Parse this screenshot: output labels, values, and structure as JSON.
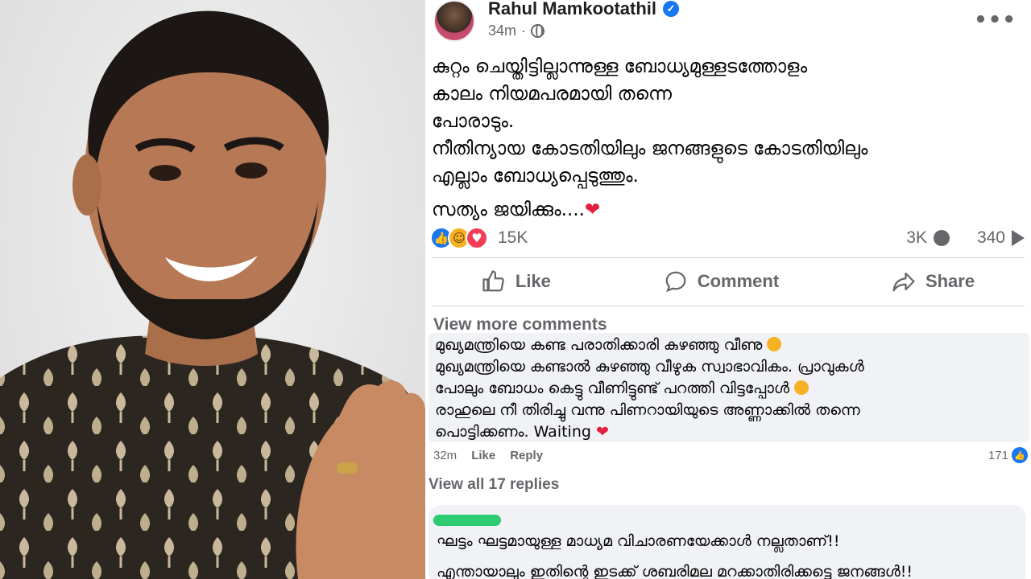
{
  "post": {
    "author": "Rahul Mamkootathil",
    "time": "34m",
    "more_icon": "more-horizontal-icon",
    "lines": [
      "കുറ്റം ചെയ്തിട്ടില്ലാന്നുള്ള ബോധ്യമുള്ളടത്തോളം",
      "കാലം നിയമപരമായി തന്നെ",
      "പോരാടും.",
      "നീതിന്യായ കോടതിയിലും ജനങ്ങളുടെ കോടതിയിലും",
      "എല്ലാം ബോധ്യപ്പെടുത്തും."
    ],
    "closing": "സത്യം ജയിക്കും....",
    "closing_emoji": "❤"
  },
  "stats": {
    "reactions": "15K",
    "comments": "3K",
    "shares": "340"
  },
  "actions": {
    "like": "Like",
    "comment": "Comment",
    "share": "Share"
  },
  "comments_section": {
    "view_more": "View more comments",
    "comment1": {
      "lines": [
        "മുഖ്യമന്ത്രിയെ കണ്ട പരാതിക്കാരി കുഴഞ്ഞു വീണു",
        "മുഖ്യമന്ത്രിയെ കണ്ടാൽ കുഴഞ്ഞു വീഴുക സ്വാഭാവികം. പ്രാവുകൾ",
        "പോലും ബോധം കെട്ടു വീണിട്ടുണ്ട് പറത്തി വിട്ടപ്പോൾ",
        "രാഹുലെ നീ തിരിച്ചു വന്നു പിണറായിയുടെ അണ്ണാക്കിൽ തന്നെ",
        "പൊട്ടിക്കണം. Waiting"
      ],
      "heart": "❤",
      "time": "32m",
      "like": "Like",
      "reply": "Reply",
      "likes": "171"
    },
    "view_replies": "View all 17 replies",
    "comment2": {
      "lines": [
        "ഘട്ടം ഘട്ടമായുള്ള മാധ്യമ വിചാരണയേക്കാൾ നല്ലതാണ്!!",
        "എന്തായാലും ഇതിന്റെ ഇടക്ക് ശബരിമല മറക്കാതിരിക്കട്ടെ ജനങ്ങൾ!!"
      ]
    }
  },
  "colors": {
    "brand_blue": "#1877f2",
    "text_gray": "#65676b",
    "comment_bg": "#f0f2f5",
    "heart_red": "#e41e3f"
  }
}
